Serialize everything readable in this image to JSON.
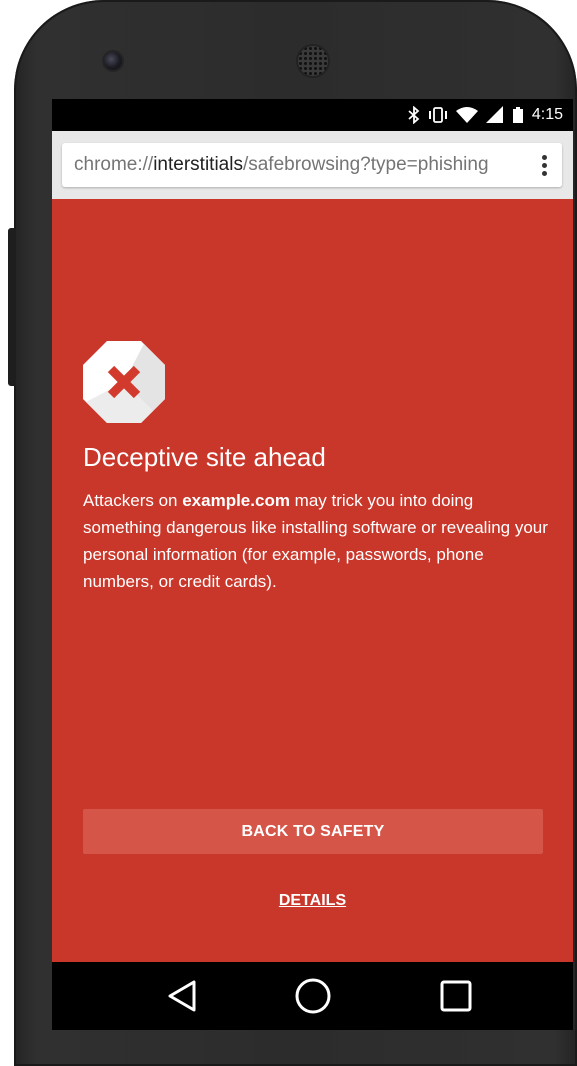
{
  "status_bar": {
    "time": "4:15",
    "icons": [
      "bluetooth-icon",
      "vibrate-icon",
      "wifi-icon",
      "signal-icon",
      "battery-icon"
    ]
  },
  "url_bar": {
    "scheme": "chrome://",
    "host": "interstitials",
    "path": "/safebrowsing?type=phishing"
  },
  "interstitial": {
    "icon": "error-x-icon",
    "heading": "Deceptive site ahead",
    "body_prefix": "Attackers on ",
    "body_domain": "example.com",
    "body_suffix": " may trick you into doing something dangerous like installing software or revealing your personal information (for example, passwords, phone numbers, or credit cards).",
    "primary_button": "BACK TO SAFETY",
    "details_link": "DETAILS"
  },
  "colors": {
    "background": "#c9362a",
    "primary_button": "#d55549",
    "icon_x": "#d23a2e"
  },
  "nav_bar": {
    "buttons": [
      "back-icon",
      "home-icon",
      "recents-icon"
    ]
  }
}
